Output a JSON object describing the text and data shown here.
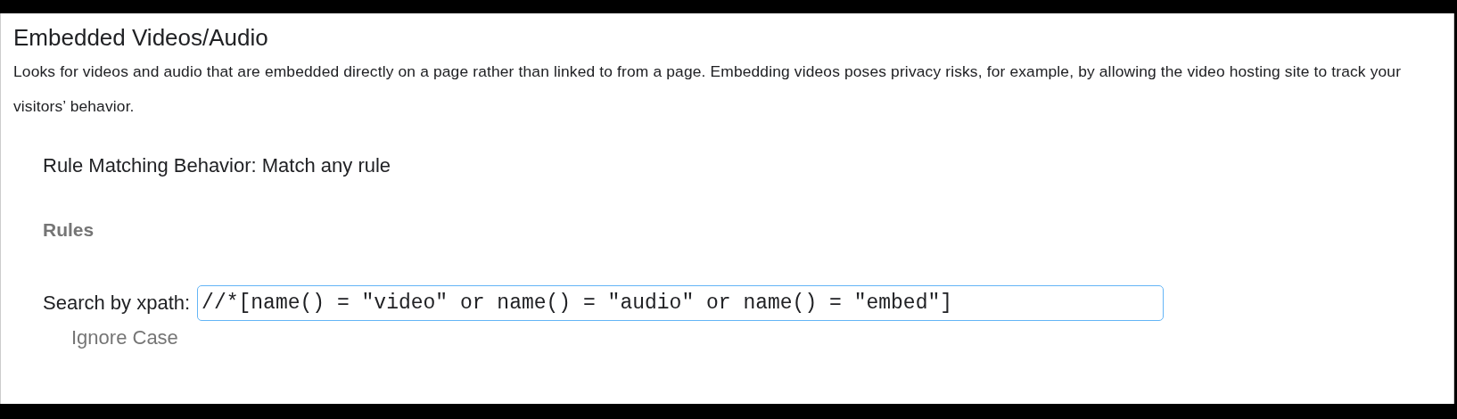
{
  "title": "Embedded Videos/Audio",
  "description": "Looks for videos and audio that are embedded directly on a page rather than linked to from a page. Embedding videos poses privacy risks, for example, by allowing the video hosting site to track your visitors’ behavior.",
  "rule_matching": "Rule Matching Behavior: Match any rule",
  "rules_heading": "Rules",
  "rules": [
    {
      "label": "Search by xpath:",
      "value": "//*[name() = \"video\" or name() = \"audio\" or name() = \"embed\"]",
      "option": "Ignore Case"
    }
  ]
}
